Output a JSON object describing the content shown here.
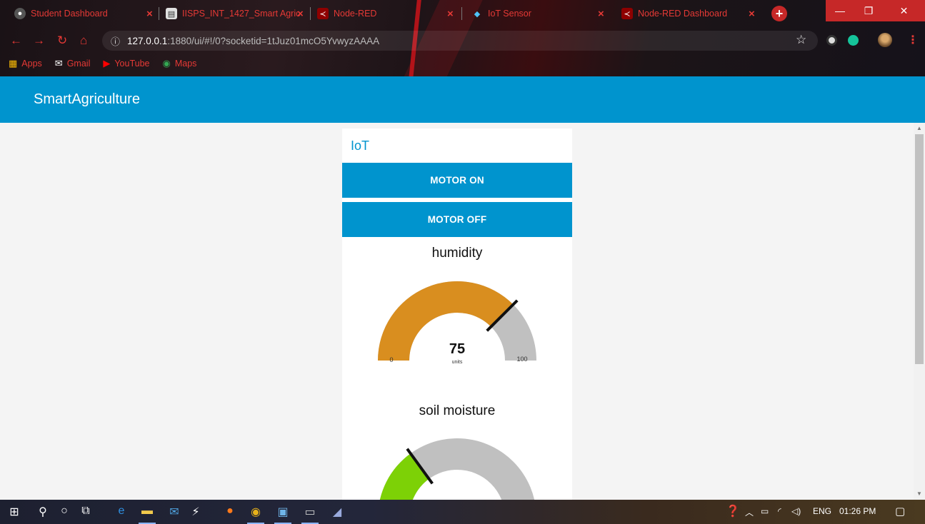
{
  "browser": {
    "tabs": [
      {
        "title": "Student Dashboard",
        "icon": "globe-icon"
      },
      {
        "title": "IISPS_INT_1427_Smart Agric",
        "icon": "document-icon"
      },
      {
        "title": "Node-RED",
        "icon": "node-red-icon"
      },
      {
        "title": "IoT Sensor",
        "icon": "iot-icon"
      },
      {
        "title": "Node-RED Dashboard",
        "icon": "node-red-icon"
      }
    ],
    "url_host": "127.0.0.1",
    "url_path": ":1880/ui/#!/0?socketid=1tJuz01mcO5YvwyzAAAA",
    "bookmarks": [
      {
        "label": "Apps"
      },
      {
        "label": "Gmail"
      },
      {
        "label": "YouTube"
      },
      {
        "label": "Maps"
      }
    ]
  },
  "dashboard": {
    "title": "SmartAgriculture",
    "group_title": "IoT",
    "buttons": {
      "motor_on": "MOTOR ON",
      "motor_off": "MOTOR OFF"
    },
    "gauges": [
      {
        "title": "humidity",
        "value": 75,
        "value_label": "75",
        "units": "units",
        "min_label": "0",
        "max_label": "100",
        "min": 0,
        "max": 100,
        "color": "#d98e1f"
      },
      {
        "title": "soil moisture",
        "value": 30,
        "min": 0,
        "max": 100,
        "color": "#7dd106"
      }
    ],
    "colors": {
      "accent": "#0094ce",
      "gauge_track": "#c0c0c0",
      "needle": "#111111"
    }
  },
  "taskbar": {
    "language": "ENG",
    "time": "01:26 PM"
  }
}
